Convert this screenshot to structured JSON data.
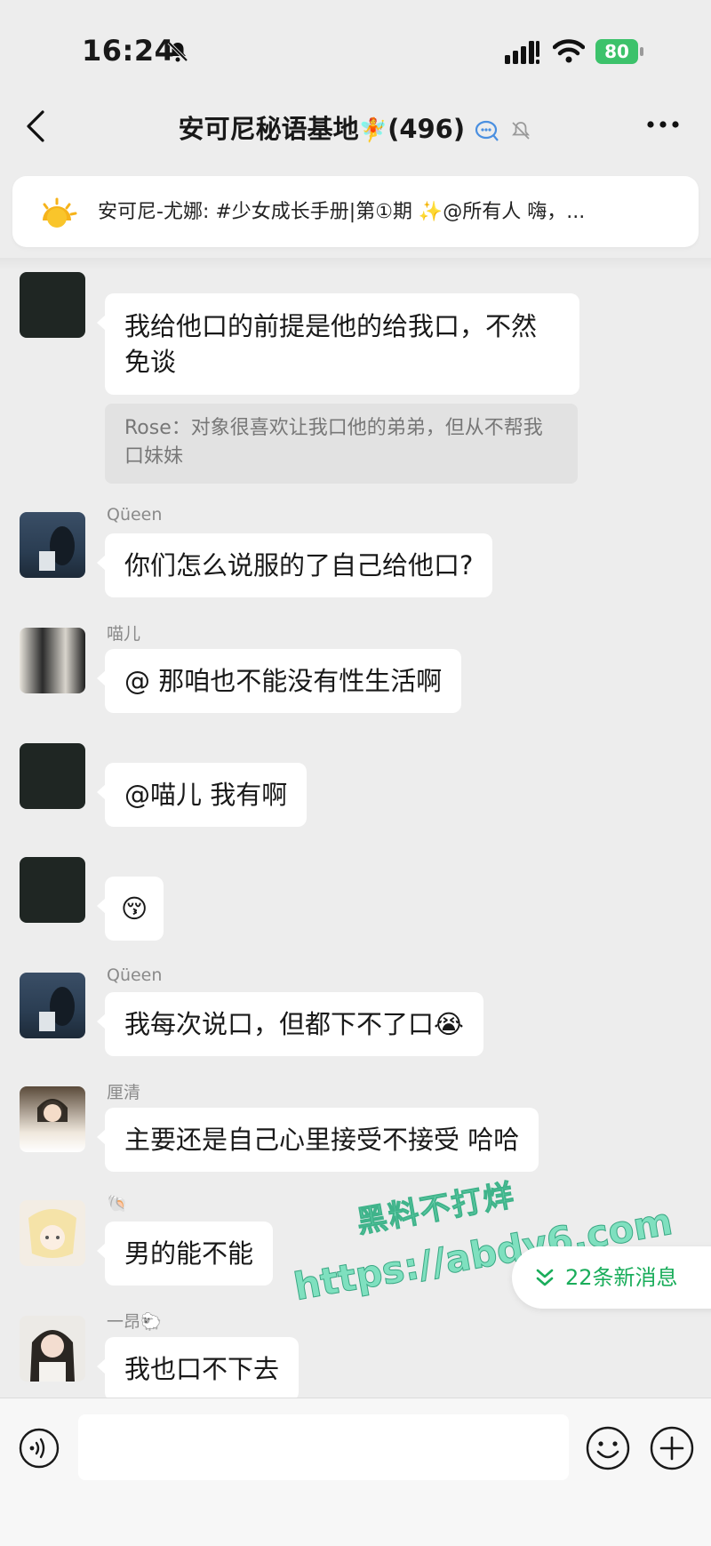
{
  "status_bar": {
    "time": "16:24",
    "battery": "80"
  },
  "header": {
    "title": "安可尼秘语基地",
    "title_emoji": "🧚",
    "member_count": "(496)"
  },
  "pinned": {
    "text": "安可尼-尤娜: #少女成长手册|第①期 ✨@所有人  嗨，..."
  },
  "messages": [
    {
      "sender": "",
      "text_line1": "我给他口的前提是他的给我口，不然",
      "text_line2": "免谈",
      "quote": "Rose：对象很喜欢让我口他的弟弟，但从不帮我口妹妹"
    },
    {
      "sender": "Qüeen",
      "text": "你们怎么说服的了自己给他口?"
    },
    {
      "sender": "喵儿",
      "text": "@ 那咱也不能没有性生活啊"
    },
    {
      "sender": "",
      "text": "@喵儿 我有啊"
    },
    {
      "sender": "",
      "text": "😚"
    },
    {
      "sender": "Qüeen",
      "text": "我每次说口，但都下不了口😭"
    },
    {
      "sender": "厘清",
      "text": "主要还是自己心里接受不接受 哈哈"
    },
    {
      "sender": "🐚",
      "text": "男的能不能"
    },
    {
      "sender": "一昂🐑",
      "text": "我也口不下去"
    }
  ],
  "new_messages": "22条新消息",
  "watermark": {
    "line1": "黑料不打烊",
    "line2": "https://abdy6.com"
  }
}
